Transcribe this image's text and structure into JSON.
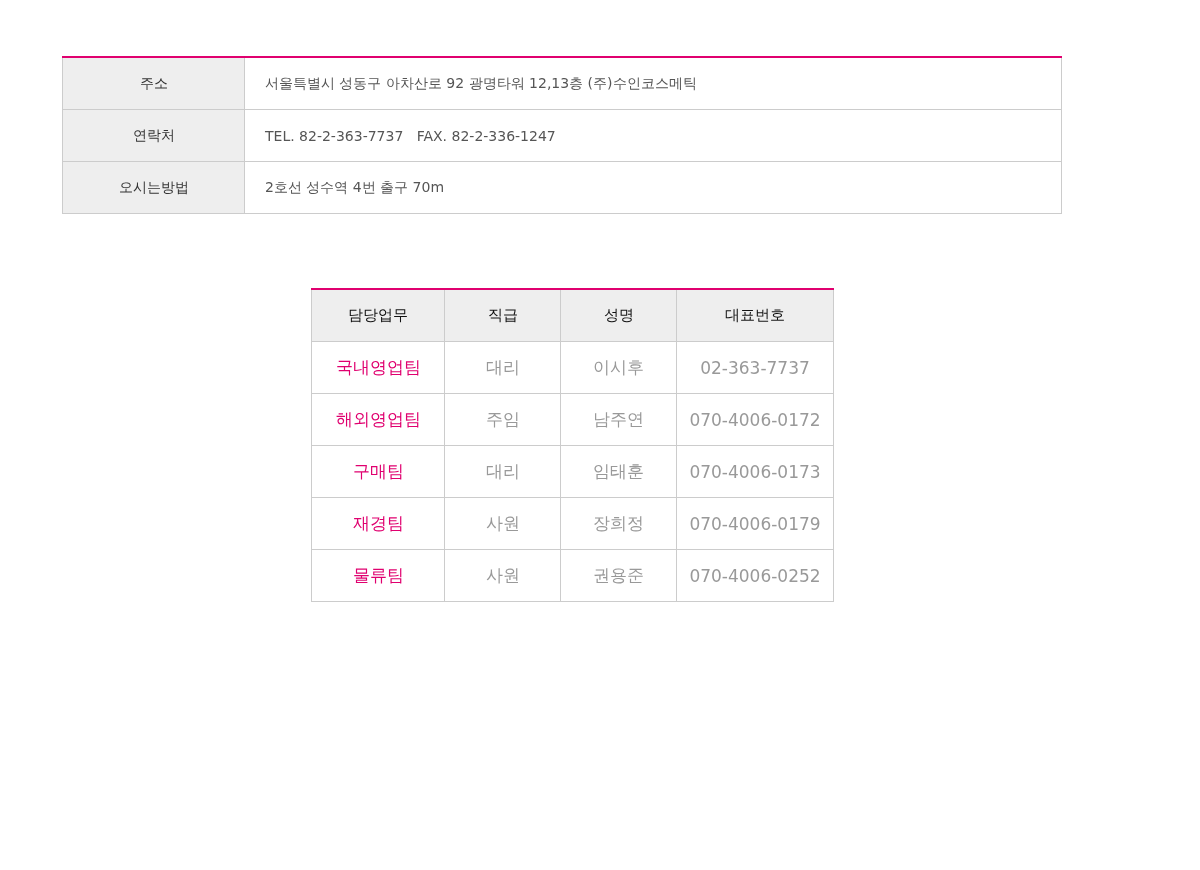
{
  "info_table": {
    "rows": [
      {
        "label": "주소",
        "value": "서울특별시 성동구 아차산로 92 광명타워 12,13층 (주)수인코스메틱"
      },
      {
        "label": "연락처",
        "value": "TEL. 82-2-363-7737   FAX. 82-2-336-1247"
      },
      {
        "label": "오시는방법",
        "value": "2호선 성수역 4번 출구 70m"
      }
    ]
  },
  "staff_table": {
    "columns": [
      "담당업무",
      "직급",
      "성명",
      "대표번호"
    ],
    "rows": [
      [
        "국내영업팀",
        "대리",
        "이시후",
        "02-363-7737"
      ],
      [
        "해외영업팀",
        "주임",
        "남주연",
        "070-4006-0172"
      ],
      [
        "구매팀",
        "대리",
        "임태훈",
        "070-4006-0173"
      ],
      [
        "재경팀",
        "사원",
        "장희정",
        "070-4006-0179"
      ],
      [
        "물류팀",
        "사원",
        "권용준",
        "070-4006-0252"
      ]
    ]
  }
}
